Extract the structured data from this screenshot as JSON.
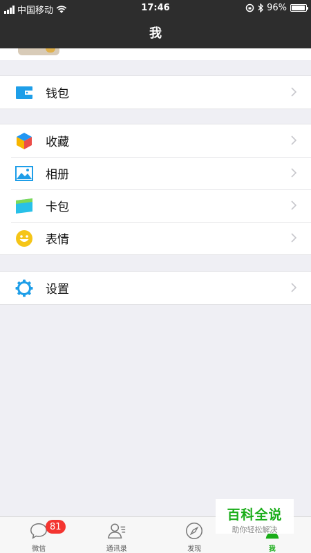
{
  "status_bar": {
    "carrier": "中国移动",
    "time": "17:46",
    "battery": "96%",
    "battery_level": 0.96
  },
  "nav": {
    "title": "我"
  },
  "groups": [
    {
      "items": [
        {
          "label": "钱包",
          "icon": "wallet-icon"
        }
      ]
    },
    {
      "items": [
        {
          "label": "收藏",
          "icon": "favorites-cube-icon"
        },
        {
          "label": "相册",
          "icon": "album-picture-icon"
        },
        {
          "label": "卡包",
          "icon": "card-bag-icon"
        },
        {
          "label": "表情",
          "icon": "smiley-face-icon"
        }
      ]
    },
    {
      "items": [
        {
          "label": "设置",
          "icon": "gear-icon"
        }
      ]
    }
  ],
  "tabbar": {
    "tabs": [
      {
        "label": "微信",
        "icon": "chat-bubble-icon",
        "badge": "81"
      },
      {
        "label": "通讯录",
        "icon": "contacts-icon"
      },
      {
        "label": "发现",
        "icon": "compass-icon"
      },
      {
        "label": "我",
        "icon": "person-icon",
        "active": true
      }
    ]
  },
  "watermark": {
    "title": "百科全说",
    "subtitle": "助你轻松解决"
  },
  "colors": {
    "nav_bg": "#2d2d2d",
    "page_bg": "#efeff4",
    "accent_green": "#1aad19",
    "badge_red": "#f43530",
    "wallet_blue": "#1e9ee8"
  }
}
